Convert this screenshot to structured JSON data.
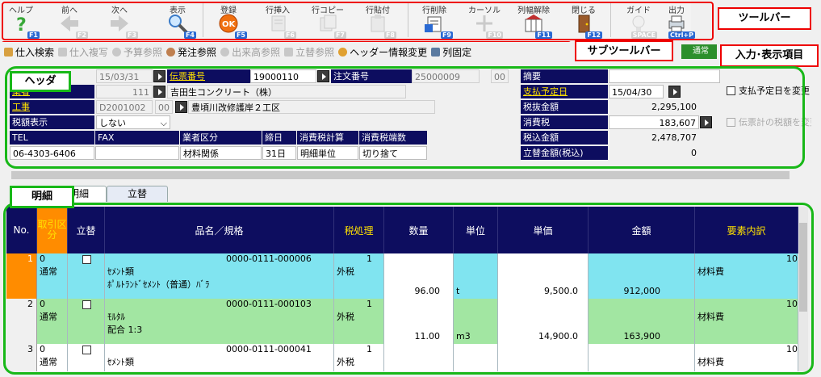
{
  "toolbar": {
    "items": [
      {
        "label": "ヘルプ",
        "key": "F1"
      },
      {
        "label": "前へ",
        "key": "F2"
      },
      {
        "label": "次へ",
        "key": "F3"
      },
      {
        "label": "表示",
        "key": "F4"
      },
      {
        "label": "登録",
        "key": "F5"
      },
      {
        "label": "行挿入",
        "key": "F6"
      },
      {
        "label": "行コピー",
        "key": "F7"
      },
      {
        "label": "行貼付",
        "key": "F8"
      },
      {
        "label": "行削除",
        "key": "F9"
      },
      {
        "label": "カーソル",
        "key": "F10"
      },
      {
        "label": "列幅解除",
        "key": "F11"
      },
      {
        "label": "閉じる",
        "key": "F12"
      },
      {
        "label": "ガイド",
        "key": "SPACE"
      },
      {
        "label": "出力",
        "key": "Ctrl+P"
      }
    ]
  },
  "callouts": {
    "toolbar": "ツールバー",
    "subtoolbar": "サブツールバー",
    "input_area": "入力･表示項目",
    "header": "ヘッダ",
    "detail": "明細"
  },
  "subtoolbar": {
    "items": [
      {
        "label": "仕入検索"
      },
      {
        "label": "仕入複写"
      },
      {
        "label": "予算参照"
      },
      {
        "label": "発注参照"
      },
      {
        "label": "出来高参照"
      },
      {
        "label": "立替参照"
      },
      {
        "label": "ヘッダー情報変更"
      },
      {
        "label": "列固定"
      }
    ],
    "status": "通常"
  },
  "header": {
    "date": "15/03/31",
    "slip_no_label": "伝票番号",
    "slip_no": "19000110",
    "order_no_label": "注文番号",
    "order_no": "25000009",
    "order_no_sub": "00",
    "vendor_label": "業者",
    "vendor_code": "111",
    "vendor_name": "吉田生コンクリート（株）",
    "work_label": "工事",
    "work_code": "D2001002",
    "work_sub": "00",
    "work_name": "豊頃川改修護岸２工区",
    "tax_disp_label": "税額表示",
    "tax_disp_value": "しない",
    "tel_label": "TEL",
    "fax_label": "FAX",
    "vendor_kind_label": "業者区分",
    "closing_label": "締日",
    "tax_calc_label": "消費税計算",
    "tax_round_label": "消費税端数",
    "tel": "06-4303-6406",
    "fax": "",
    "vendor_kind": "材料関係",
    "closing": "31日",
    "tax_calc": "明細単位",
    "tax_round": "切り捨て",
    "memo_label": "摘要",
    "memo": "",
    "pay_date_label": "支払予定日",
    "pay_date": "15/04/30",
    "pay_change_label": "支払予定日を変更",
    "pretax_label": "税抜金額",
    "pretax": "2,295,100",
    "tax_label": "消費税",
    "tax": "183,607",
    "slip_tax_change_label": "伝票計の税額を変更",
    "total_label": "税込金額",
    "total": "2,478,707",
    "advance_label": "立替金額(税込)",
    "advance": "0"
  },
  "tabs": [
    {
      "label": "明細"
    },
    {
      "label": "立替"
    }
  ],
  "grid": {
    "columns": [
      {
        "label": "No."
      },
      {
        "label": "取引区分"
      },
      {
        "label": "立替"
      },
      {
        "label": "品名／規格"
      },
      {
        "label": "税処理"
      },
      {
        "label": "数量"
      },
      {
        "label": "単位"
      },
      {
        "label": "単価"
      },
      {
        "label": "金額"
      },
      {
        "label": "要素内訳"
      }
    ],
    "rows": [
      {
        "no": "1",
        "kbn_code": "0",
        "kbn": "通常",
        "code": "0000-0111-000006",
        "name1": "ｾﾒﾝﾄ類",
        "name2": "ﾎﾟﾙﾄﾗﾝﾄﾞｾﾒﾝﾄ（普通）ﾊﾞﾗ",
        "tax_code": "1",
        "tax": "外税",
        "qty": "96.00",
        "unit": "t",
        "price": "9,500.0",
        "amount": "912,000",
        "element": "材料費",
        "element_code": "10"
      },
      {
        "no": "2",
        "kbn_code": "0",
        "kbn": "通常",
        "code": "0000-0111-000103",
        "name1": "ﾓﾙﾀﾙ",
        "name2": "配合 1:3",
        "tax_code": "1",
        "tax": "外税",
        "qty": "11.00",
        "unit": "m3",
        "price": "14,900.0",
        "amount": "163,900",
        "element": "材料費",
        "element_code": "10"
      },
      {
        "no": "3",
        "kbn_code": "0",
        "kbn": "通常",
        "code": "0000-0111-000041",
        "name1": "ｾﾒﾝﾄ類",
        "name2": "",
        "tax_code": "1",
        "tax": "外税",
        "qty": "",
        "unit": "",
        "price": "",
        "amount": "",
        "element": "材料費",
        "element_code": "10"
      }
    ]
  },
  "colors": {
    "accent": "#0d0d5f",
    "highlight": "#ff8c00",
    "callout_red": "#ee0000",
    "callout_green": "#18b818",
    "row1": "#80e4f0",
    "row2": "#a2e6a2"
  }
}
